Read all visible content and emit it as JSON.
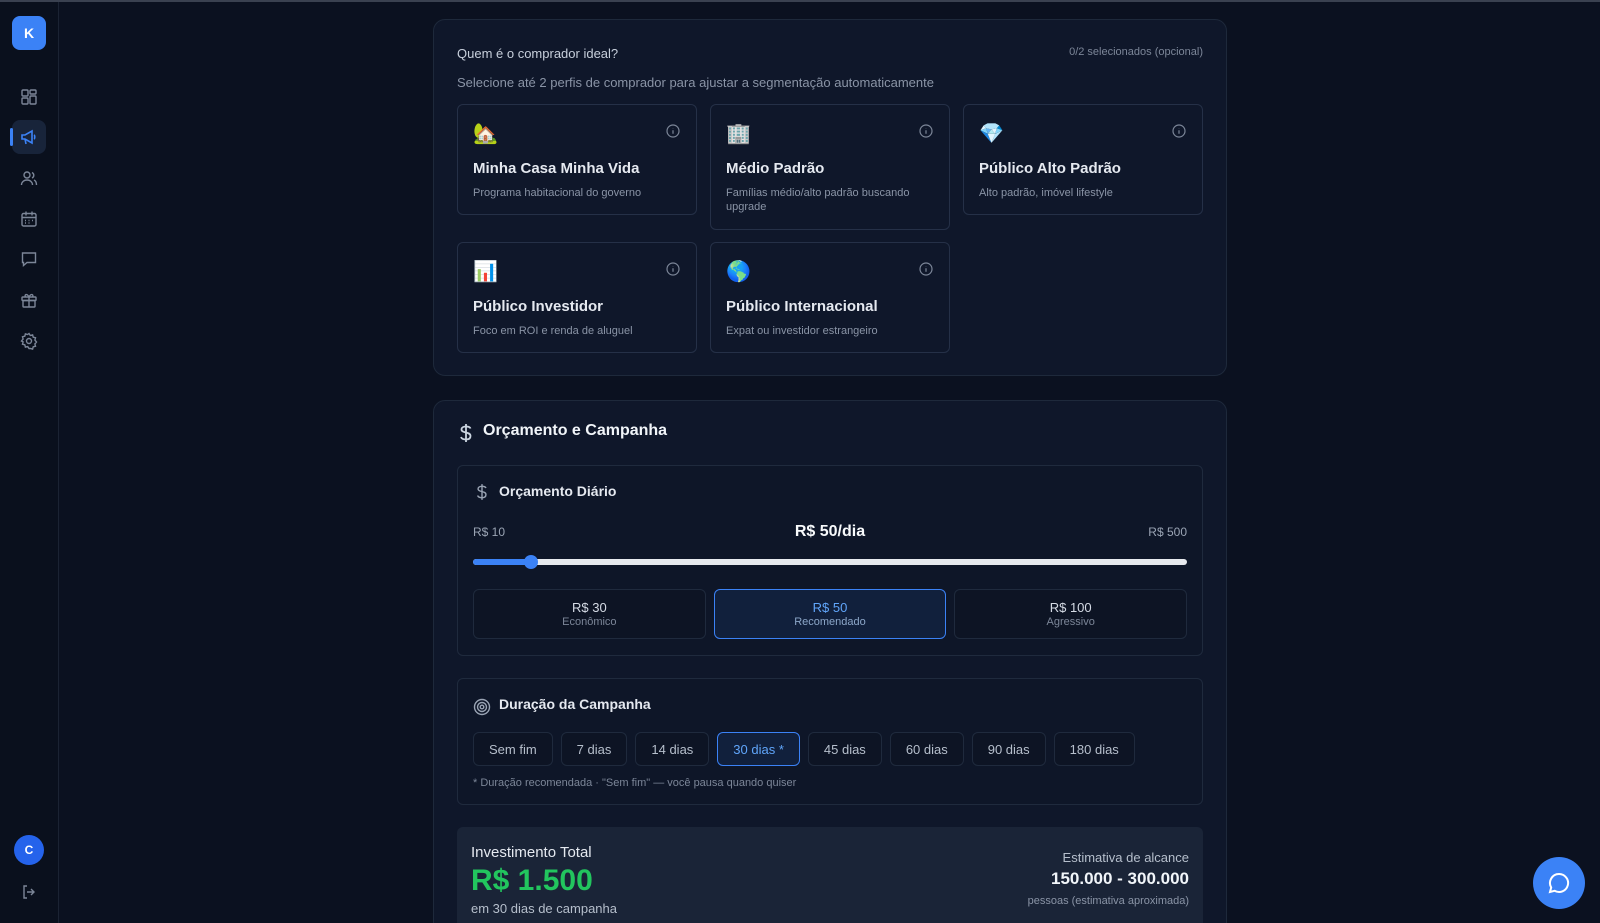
{
  "sidebar": {
    "brand_letter": "K",
    "user_initial": "C",
    "nav": [
      {
        "icon": "dashboard-grid-icon"
      },
      {
        "icon": "megaphone-icon",
        "active": true
      },
      {
        "icon": "users-icon"
      },
      {
        "icon": "calendar-icon"
      },
      {
        "icon": "chat-icon"
      },
      {
        "icon": "gift-icon"
      },
      {
        "icon": "gear-icon"
      }
    ]
  },
  "buyer": {
    "title": "Quem é o comprador ideal?",
    "count": "0/2 selecionados (opcional)",
    "subtitle": "Selecione até 2 perfis de comprador para ajustar a segmentação automaticamente",
    "profiles": [
      {
        "emoji": "🏡",
        "name": "Minha Casa Minha Vida",
        "desc": "Programa habitacional do governo"
      },
      {
        "emoji": "🏢",
        "name": "Médio Padrão",
        "desc": "Famílias médio/alto padrão buscando upgrade"
      },
      {
        "emoji": "💎",
        "name": "Público Alto Padrão",
        "desc": "Alto padrão, imóvel lifestyle"
      },
      {
        "emoji": "📊",
        "name": "Público Investidor",
        "desc": "Foco em ROI e renda de aluguel"
      },
      {
        "emoji": "🌎",
        "name": "Público Internacional",
        "desc": "Expat ou investidor estrangeiro"
      }
    ]
  },
  "budget": {
    "title": "Orçamento e Campanha",
    "daily": {
      "title": "Orçamento Diário",
      "min_label": "R$ 10",
      "max_label": "R$ 500",
      "current_label": "R$ 50/dia",
      "min": 10,
      "max": 500,
      "value": 50,
      "presets": [
        {
          "value": "R$ 30",
          "label": "Econômico"
        },
        {
          "value": "R$ 50",
          "label": "Recomendado",
          "selected": true
        },
        {
          "value": "R$ 100",
          "label": "Agressivo"
        }
      ]
    },
    "duration": {
      "title": "Duração da Campanha",
      "options": [
        "Sem fim",
        "7 dias",
        "14 dias",
        "30 dias *",
        "45 dias",
        "60 dias",
        "90 dias",
        "180 dias"
      ],
      "selected": "30 dias *",
      "note": "* Duração recomendada · \"Sem fim\" — você pausa quando quiser"
    },
    "total": {
      "label": "Investimento Total",
      "value": "R$ 1.500",
      "sub": "em 30 dias de campanha",
      "reach_label": "Estimativa de alcance",
      "reach_value": "150.000 - 300.000",
      "reach_sub": "pessoas (estimativa aproximada)"
    }
  },
  "colors": {
    "accent": "#3b82f6",
    "success": "#22c55e",
    "background": "#0b1120"
  }
}
